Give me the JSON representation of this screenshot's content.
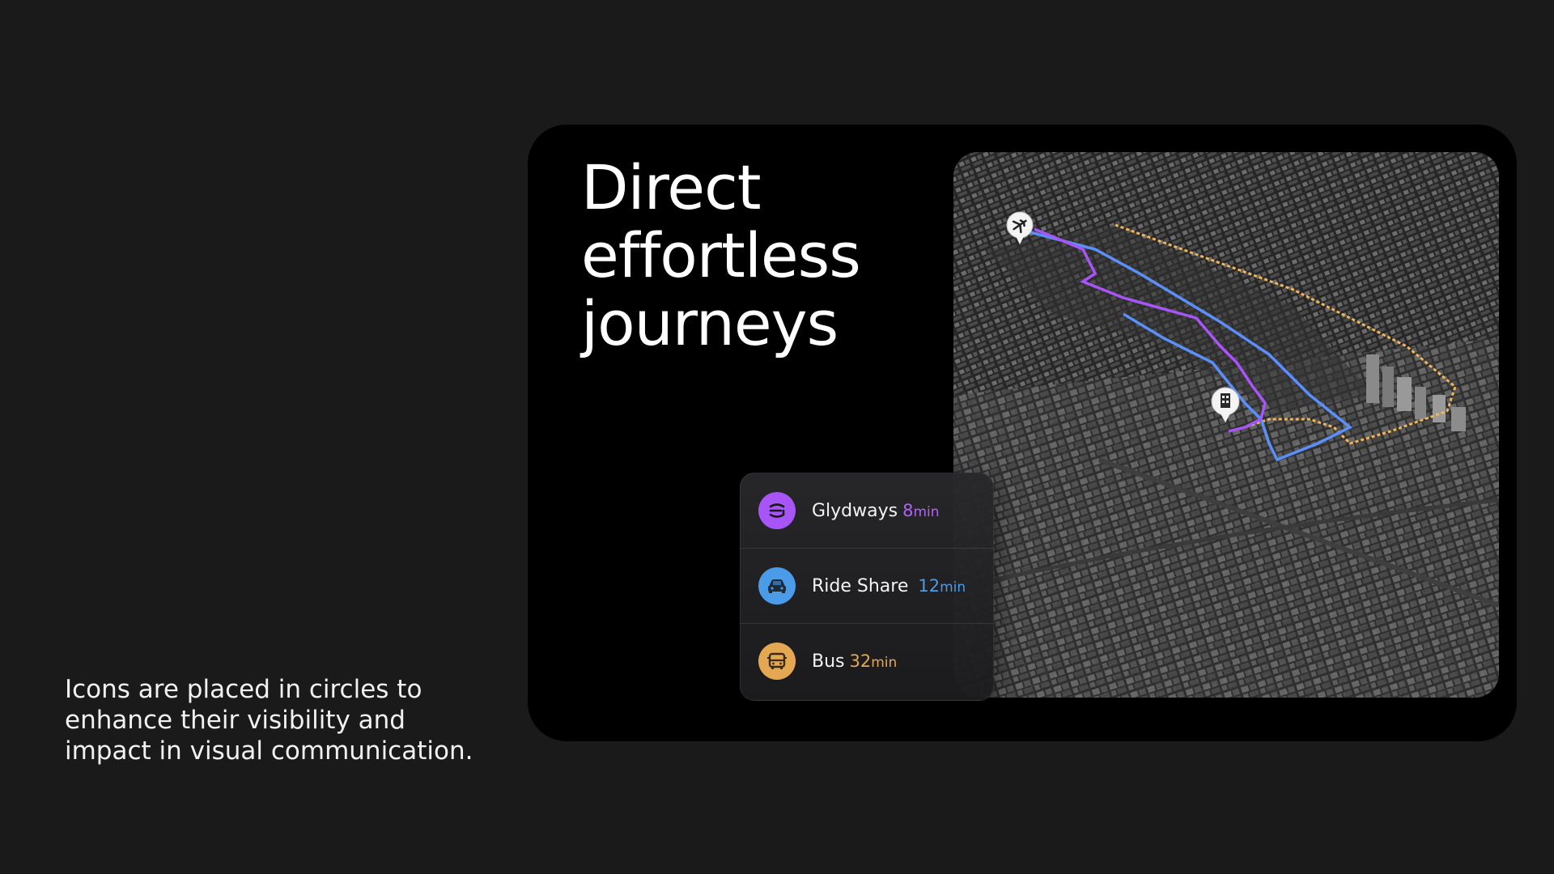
{
  "caption": "Icons are placed in circles to enhance their visibility and impact in visual communication.",
  "headline": [
    "Direct",
    "effortless",
    "journeys"
  ],
  "map": {
    "pins": [
      {
        "icon": "airplane-icon"
      },
      {
        "icon": "building-icon"
      }
    ],
    "route_colors": {
      "glydways": "#a855f7",
      "ride_share": "#5b8ff9",
      "bus": "#f2b65a"
    }
  },
  "options": [
    {
      "name": "Glydways",
      "time_value": "8",
      "time_unit": "min",
      "color": "#a855f7",
      "icon": "glydways-logo-icon"
    },
    {
      "name": "Ride Share",
      "time_value": "12",
      "time_unit": "min",
      "color": "#4a9be8",
      "icon": "car-icon"
    },
    {
      "name": "Bus",
      "time_value": "32",
      "time_unit": "min",
      "color": "#e4a853",
      "icon": "bus-icon"
    }
  ]
}
